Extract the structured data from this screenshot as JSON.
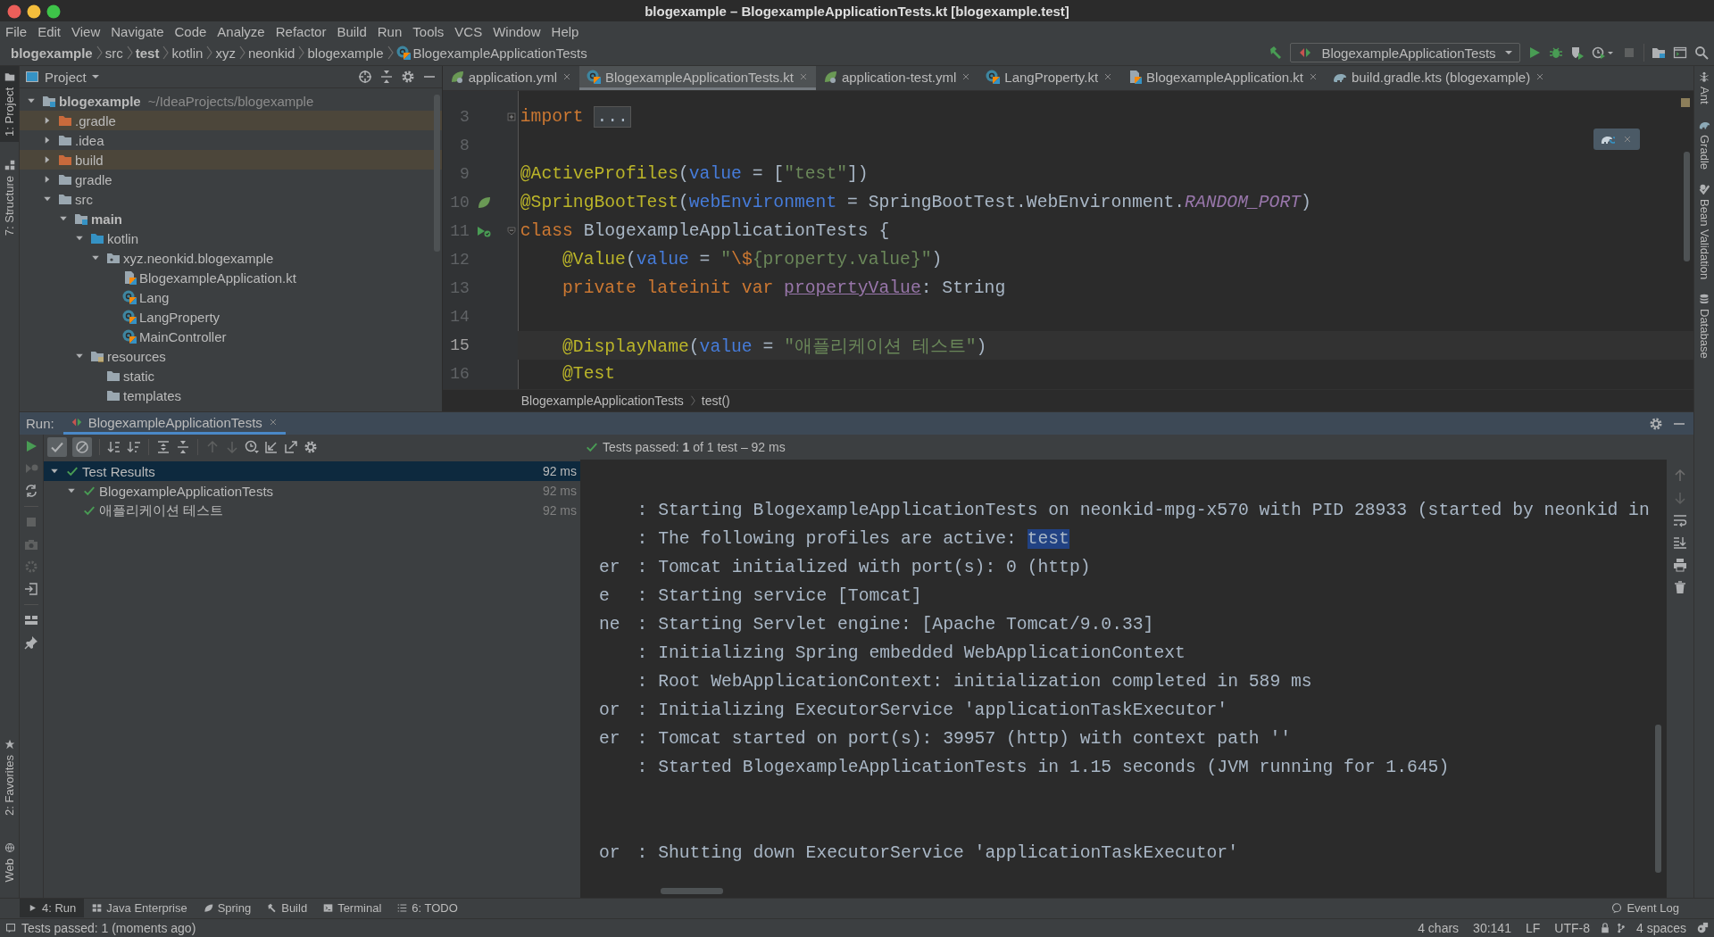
{
  "window": {
    "title": "blogexample – BlogexampleApplicationTests.kt [blogexample.test]"
  },
  "menu": [
    "File",
    "Edit",
    "View",
    "Navigate",
    "Code",
    "Analyze",
    "Refactor",
    "Build",
    "Run",
    "Tools",
    "VCS",
    "Window",
    "Help"
  ],
  "breadcrumbs": [
    {
      "label": "blogexample",
      "kind": "root"
    },
    {
      "label": "src",
      "kind": "folder"
    },
    {
      "label": "test",
      "kind": "root"
    },
    {
      "label": "kotlin",
      "kind": "folder"
    },
    {
      "label": "xyz",
      "kind": "folder"
    },
    {
      "label": "neonkid",
      "kind": "folder"
    },
    {
      "label": "blogexample",
      "kind": "folder"
    },
    {
      "label": "BlogexampleApplicationTests",
      "kind": "class"
    }
  ],
  "run_config": {
    "label": "BlogexampleApplicationTests"
  },
  "left_strip": {
    "top": [
      {
        "label": "1: Project",
        "selected": true
      },
      {
        "label": "7: Structure",
        "selected": false
      }
    ],
    "bottom": [
      {
        "label": "2: Favorites",
        "selected": false
      },
      {
        "label": "Web",
        "selected": false
      }
    ]
  },
  "right_strip": [
    {
      "label": "Ant",
      "kind": "ant"
    },
    {
      "label": "Gradle",
      "kind": "gradle"
    },
    {
      "label": "Bean Validation",
      "kind": "bean"
    },
    {
      "label": "Database",
      "kind": "database"
    }
  ],
  "project": {
    "title": "Project",
    "tree": [
      {
        "label": "blogexample",
        "hint": "~/IdeaProjects/blogexample",
        "kind": "module",
        "excluded": false,
        "expanded": true,
        "children": [
          {
            "label": ".gradle",
            "kind": "folder",
            "excluded": true,
            "expanded": false
          },
          {
            "label": ".idea",
            "kind": "folder",
            "excluded": false,
            "expanded": false
          },
          {
            "label": "build",
            "kind": "folder",
            "excluded": true,
            "expanded": false
          },
          {
            "label": "gradle",
            "kind": "folder",
            "excluded": false,
            "expanded": false
          },
          {
            "label": "src",
            "kind": "folder",
            "excluded": false,
            "expanded": true,
            "children": [
              {
                "label": "main",
                "kind": "module",
                "excluded": false,
                "expanded": true,
                "children": [
                  {
                    "label": "kotlin",
                    "kind": "source",
                    "excluded": false,
                    "expanded": true,
                    "children": [
                      {
                        "label": "xyz.neonkid.blogexample",
                        "kind": "package",
                        "excluded": false,
                        "expanded": true,
                        "children": [
                          {
                            "label": "BlogexampleApplication.kt",
                            "kind": "file",
                            "excluded": false
                          },
                          {
                            "label": "Lang",
                            "kind": "class",
                            "excluded": false
                          },
                          {
                            "label": "LangProperty",
                            "kind": "class",
                            "excluded": false
                          },
                          {
                            "label": "MainController",
                            "kind": "class",
                            "excluded": false
                          }
                        ]
                      }
                    ]
                  },
                  {
                    "label": "resources",
                    "kind": "resources",
                    "excluded": false,
                    "expanded": true,
                    "children": [
                      {
                        "label": "static",
                        "kind": "folder",
                        "excluded": false
                      },
                      {
                        "label": "templates",
                        "kind": "folder",
                        "excluded": false
                      }
                    ]
                  }
                ]
              }
            ]
          }
        ]
      }
    ]
  },
  "editor": {
    "tabs": [
      {
        "label": "application.yml",
        "kind": "spring",
        "selected": false
      },
      {
        "label": "BlogexampleApplicationTests.kt",
        "kind": "class",
        "selected": true
      },
      {
        "label": "application-test.yml",
        "kind": "spring",
        "selected": false
      },
      {
        "label": "LangProperty.kt",
        "kind": "class",
        "selected": false
      },
      {
        "label": "BlogexampleApplication.kt",
        "kind": "file",
        "selected": false
      },
      {
        "label": "build.gradle.kts (blogexample)",
        "kind": "gradle",
        "selected": false
      }
    ],
    "lines": [
      {
        "number": "3",
        "current": false,
        "indented": false,
        "fold_start": true,
        "collapsed": true,
        "tokens": [
          {
            "text": "import ",
            "kind": "keyword"
          },
          {
            "text": "...",
            "kind": "folded"
          }
        ]
      },
      {
        "number": "8",
        "current": false,
        "fold_start": false
      },
      {
        "number": "9",
        "current": false,
        "indented": false,
        "fold_start": false,
        "tokens": [
          {
            "text": "@ActiveProfiles",
            "kind": "annotation"
          },
          {
            "text": "(",
            "kind": "plain"
          },
          {
            "text": "value",
            "kind": "param"
          },
          {
            "text": " = [",
            "kind": "plain"
          },
          {
            "text": "\"test\"",
            "kind": "string"
          },
          {
            "text": "])",
            "kind": "plain"
          }
        ]
      },
      {
        "number": "10",
        "current": false,
        "indented": false,
        "fold_start": false,
        "gutter": {
          "kind": "spring"
        },
        "tokens": [
          {
            "text": "@SpringBootTest",
            "kind": "annotation"
          },
          {
            "text": "(",
            "kind": "plain"
          },
          {
            "text": "webEnvironment",
            "kind": "param"
          },
          {
            "text": " = SpringBootTest.WebEnvironment.",
            "kind": "plain"
          },
          {
            "text": "RANDOM_PORT",
            "kind": "constant"
          },
          {
            "text": ")",
            "kind": "plain"
          }
        ]
      },
      {
        "number": "11",
        "current": false,
        "indented": false,
        "gutter": {
          "kind": "run"
        },
        "fold_start": true,
        "collapsed": false,
        "tokens": [
          {
            "text": "class ",
            "kind": "keyword"
          },
          {
            "text": "BlogexampleApplicationTests {",
            "kind": "plain"
          }
        ]
      },
      {
        "number": "12",
        "current": false,
        "indented": true,
        "fold_start": false,
        "tokens": [
          {
            "text": "@Value",
            "kind": "annotation"
          },
          {
            "text": "(",
            "kind": "plain"
          },
          {
            "text": "value",
            "kind": "param"
          },
          {
            "text": " = ",
            "kind": "plain"
          },
          {
            "text": "\"",
            "kind": "string"
          },
          {
            "text": "\\$",
            "kind": "escape"
          },
          {
            "text": "{property.value}\"",
            "kind": "string"
          },
          {
            "text": ")",
            "kind": "plain"
          }
        ]
      },
      {
        "number": "13",
        "current": false,
        "indented": true,
        "fold_start": false,
        "tokens": [
          {
            "text": "private lateinit var ",
            "kind": "keyword"
          },
          {
            "text": "propertyValue",
            "kind": "property"
          },
          {
            "text": ": String",
            "kind": "plain"
          }
        ]
      },
      {
        "number": "14",
        "current": false,
        "fold_start": false
      },
      {
        "number": "15",
        "current": true,
        "indented": true,
        "fold_start": false,
        "tokens": [
          {
            "text": "@DisplayName",
            "kind": "annotation"
          },
          {
            "text": "(",
            "kind": "plain"
          },
          {
            "text": "value",
            "kind": "param"
          },
          {
            "text": " = ",
            "kind": "plain"
          },
          {
            "text": "\"애플리케이션 테스트\"",
            "kind": "string"
          },
          {
            "text": ")",
            "kind": "plain"
          }
        ]
      },
      {
        "number": "16",
        "current": false,
        "indented": true,
        "fold_start": false,
        "tokens": [
          {
            "text": "@Test",
            "kind": "annotation"
          }
        ]
      }
    ],
    "breadcrumbs": [
      "BlogexampleApplicationTests",
      "test()"
    ]
  },
  "run": {
    "label": "Run:",
    "tabs": [
      {
        "label": "BlogexampleApplicationTests",
        "selected": true
      }
    ],
    "filters": {
      "show_passed": true,
      "show_ignored": true
    },
    "summary": "Tests passed: **1** of 1 test – 92 ms",
    "results": [
      {
        "label": "Test Results",
        "time": "92 ms",
        "selected": true,
        "expanded": true,
        "children": [
          {
            "label": "BlogexampleApplicationTests",
            "time": "92 ms",
            "selected": false,
            "expanded": true,
            "children": [
              {
                "label": "애플리케이션 테스트",
                "time": "92 ms",
                "selected": false
              }
            ]
          }
        ]
      }
    ],
    "console": [
      {
        "kind": "log",
        "text": ": Starting BlogexampleApplicationTests on neonkid-mpg-x570 with PID 28933 (started by neonkid in"
      },
      {
        "kind": "log",
        "text": ": The following profiles are active: ",
        "highlight": "test"
      },
      {
        "kind": "log",
        "prefix": "er",
        "text": ": Tomcat initialized with port(s): 0 (http)"
      },
      {
        "kind": "log",
        "prefix": "e",
        "text": ": Starting service [Tomcat]"
      },
      {
        "kind": "log",
        "prefix": "ne",
        "text": ": Starting Servlet engine: [Apache Tomcat/9.0.33]"
      },
      {
        "kind": "log",
        "text": ": Initializing Spring embedded WebApplicationContext"
      },
      {
        "kind": "log",
        "text": ": Root WebApplicationContext: initialization completed in 589 ms"
      },
      {
        "kind": "log",
        "prefix": "or",
        "text": ": Initializing ExecutorService 'applicationTaskExecutor'"
      },
      {
        "kind": "log",
        "prefix": "er",
        "text": ": Tomcat started on port(s): 39957 (http) with context path ''"
      },
      {
        "kind": "log",
        "text": ": Started BlogexampleApplicationTests in 1.15 seconds (JVM running for 1.645)"
      },
      {
        "kind": "blank"
      },
      {
        "kind": "blank"
      },
      {
        "kind": "log",
        "prefix": "or",
        "text": ": Shutting down ExecutorService 'applicationTaskExecutor'"
      }
    ]
  },
  "bottom_tools": [
    {
      "label": "4: Run",
      "kind": "run",
      "selected": true
    },
    {
      "label": "Java Enterprise",
      "kind": "enterprise",
      "selected": false
    },
    {
      "label": "Spring",
      "kind": "spring",
      "selected": false
    },
    {
      "label": "Build",
      "kind": "build",
      "selected": false
    },
    {
      "label": "Terminal",
      "kind": "terminal",
      "selected": false
    },
    {
      "label": "6: TODO",
      "kind": "todo",
      "selected": false
    }
  ],
  "event_log": "Event Log",
  "status": {
    "message": "Tests passed: 1 (moments ago)",
    "items": [
      "4 chars",
      "30:141",
      "LF",
      "UTF-8",
      "4 spaces"
    ]
  }
}
